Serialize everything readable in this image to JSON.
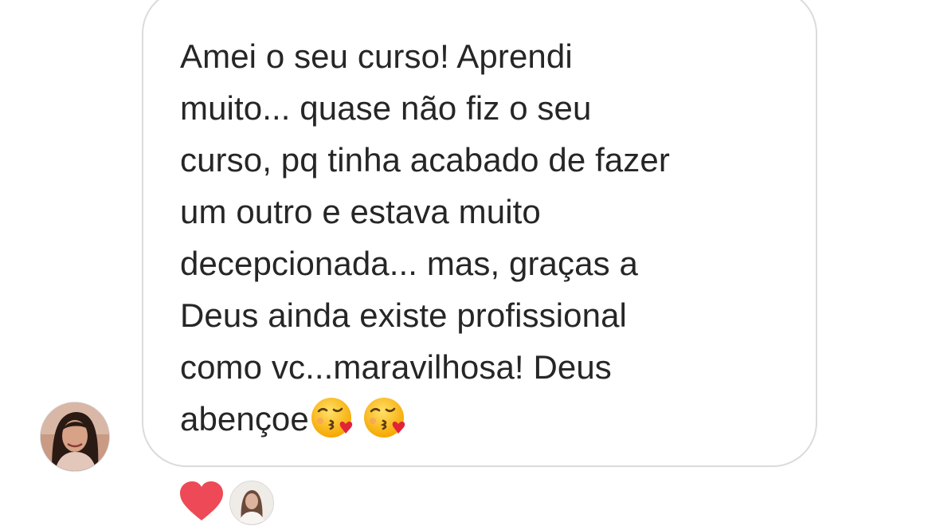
{
  "conversation": {
    "sender_avatar": "profile-photo-woman",
    "message": {
      "lines": [
        "Amei o seu curso! Aprendi",
        "muito... quase não fiz o seu",
        "curso, pq tinha acabado de fazer",
        "um outro e estava muito",
        "decepcionada... mas, graças a",
        "Deus ainda existe profissional",
        "como vc...maravilhosa! Deus",
        "abençoe"
      ],
      "emojis": [
        "face-blowing-a-kiss-icon",
        "face-blowing-a-kiss-icon"
      ]
    },
    "reactions": {
      "icon": "heart-icon",
      "color": "#ed4956",
      "reactor_avatar": "profile-photo-reactor"
    }
  },
  "colors": {
    "text": "#262626",
    "bubble_border": "#dbdbdb",
    "background": "#ffffff"
  }
}
